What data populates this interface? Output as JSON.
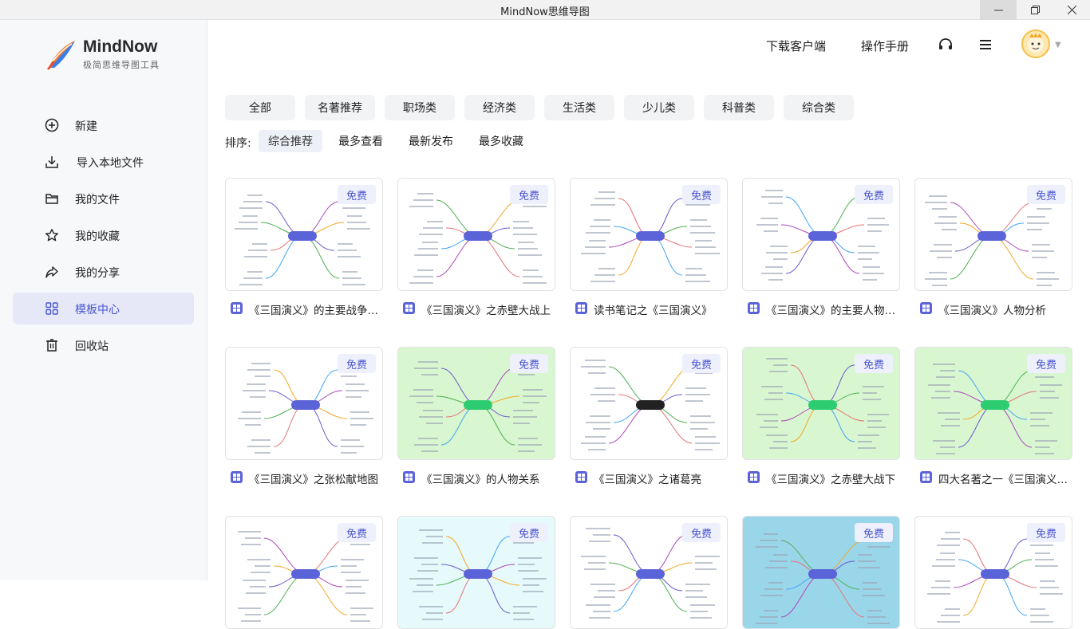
{
  "window": {
    "title": "MindNow思维导图"
  },
  "logo": {
    "name": "MindNow",
    "subtitle": "极简思维导图工具"
  },
  "sidebar": {
    "items": [
      {
        "label": "新建",
        "icon": "plus-circle-icon"
      },
      {
        "label": "导入本地文件",
        "icon": "download-icon"
      },
      {
        "label": "我的文件",
        "icon": "folder-icon"
      },
      {
        "label": "我的收藏",
        "icon": "star-icon"
      },
      {
        "label": "我的分享",
        "icon": "share-icon"
      },
      {
        "label": "模板中心",
        "icon": "grid-icon",
        "active": true
      },
      {
        "label": "回收站",
        "icon": "trash-icon"
      }
    ]
  },
  "header": {
    "download_client": "下载客户端",
    "manual": "操作手册"
  },
  "categories": [
    "全部",
    "名著推荐",
    "职场类",
    "经济类",
    "生活类",
    "少儿类",
    "科普类",
    "综合类"
  ],
  "sort": {
    "label": "排序:",
    "options": [
      "综合推荐",
      "最多查看",
      "最新发布",
      "最多收藏"
    ],
    "active": 0
  },
  "badge_text": "免费",
  "templates": [
    {
      "title": "《三国演义》的主要战争…",
      "bg": "white"
    },
    {
      "title": "《三国演义》之赤壁大战上",
      "bg": "white"
    },
    {
      "title": "读书笔记之《三国演义》",
      "bg": "white"
    },
    {
      "title": "《三国演义》的主要人物…",
      "bg": "white"
    },
    {
      "title": "《三国演义》人物分析",
      "bg": "white"
    },
    {
      "title": "《三国演义》之张松献地图",
      "bg": "white"
    },
    {
      "title": "《三国演义》的人物关系",
      "bg": "green"
    },
    {
      "title": "《三国演义》之诸葛亮",
      "bg": "white"
    },
    {
      "title": "《三国演义》之赤壁大战下",
      "bg": "green"
    },
    {
      "title": "四大名著之一《三国演义…",
      "bg": "green"
    },
    {
      "title": "",
      "bg": "white"
    },
    {
      "title": "",
      "bg": "cyan"
    },
    {
      "title": "",
      "bg": "white"
    },
    {
      "title": "",
      "bg": "blue"
    },
    {
      "title": "",
      "bg": "white"
    }
  ],
  "colors": {
    "accent": "#4a56d0",
    "active_bg": "#e6e8f8",
    "badge_bg": "#eef0fb"
  }
}
